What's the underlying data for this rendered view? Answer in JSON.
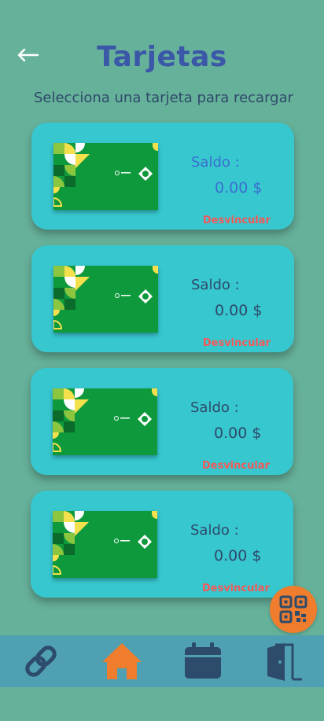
{
  "header": {
    "title": "Tarjetas",
    "subtitle": "Selecciona una tarjeta para recargar"
  },
  "cards": [
    {
      "saldo_label": "Saldo :",
      "saldo_value": "0.00 $",
      "unlink_label": "Desvincular"
    },
    {
      "saldo_label": "Saldo :",
      "saldo_value": "0.00 $",
      "unlink_label": "Desvincular"
    },
    {
      "saldo_label": "Saldo :",
      "saldo_value": "0.00 $",
      "unlink_label": "Desvincular"
    },
    {
      "saldo_label": "Saldo :",
      "saldo_value": "0.00 $",
      "unlink_label": "Desvincular"
    }
  ],
  "icons": {
    "back": "arrow-left-icon",
    "qr": "qr-code-icon",
    "nav": [
      "link-icon",
      "home-icon",
      "calendar-icon",
      "door-exit-icon"
    ]
  },
  "colors": {
    "background": "#66b19a",
    "card": "#37c7cf",
    "title": "#3b57a8",
    "unlink": "#f25a5a",
    "fab": "#f07d2e",
    "nav_bar": "#4fa0b3",
    "nav_icon": "#2d4b6b",
    "nav_active": "#f07d2e",
    "card_green": "#0e9a3c"
  }
}
